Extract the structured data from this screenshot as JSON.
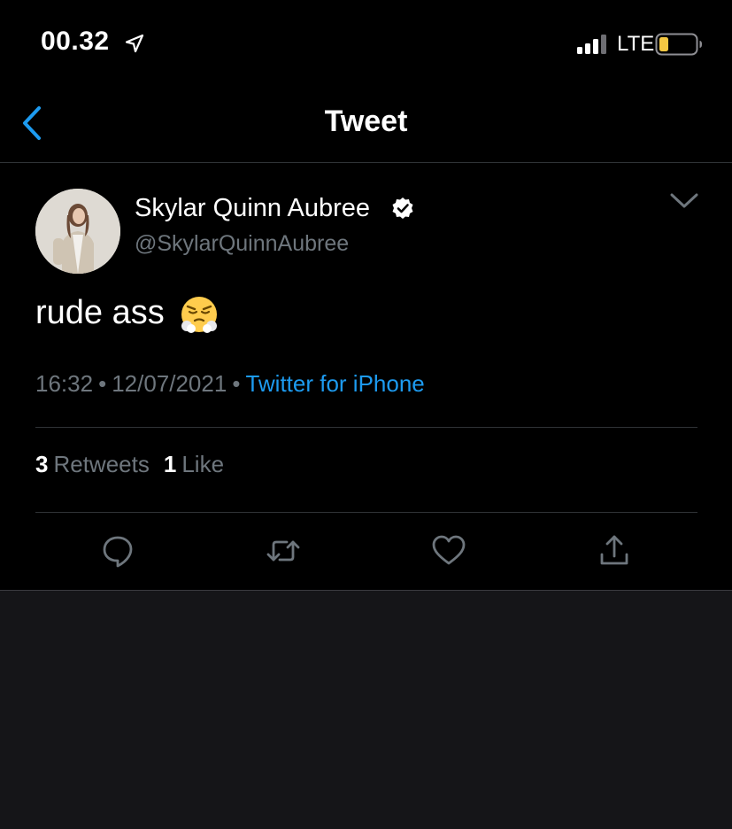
{
  "status_bar": {
    "time": "00.32",
    "network": "LTE",
    "icons": [
      "location-arrow-icon",
      "signal-bars-icon",
      "battery-low-icon"
    ]
  },
  "nav": {
    "title": "Tweet",
    "back_icon": "chevron-left-icon"
  },
  "tweet": {
    "author": {
      "display_name": "Skylar Quinn Aubree",
      "handle": "@SkylarQuinnAubree",
      "verified": true
    },
    "text": "rude ass",
    "emoji": "😤",
    "time": "16:32",
    "date": "12/07/2021",
    "source": "Twitter for iPhone",
    "separator": "•",
    "stats": {
      "retweets_count": "3",
      "retweets_label": "Retweets",
      "likes_count": "1",
      "likes_label": "Like"
    },
    "actions": [
      "reply-icon",
      "retweet-icon",
      "like-icon",
      "share-icon"
    ]
  },
  "colors": {
    "background": "#000000",
    "accent": "#1d9bf0",
    "secondary_text": "#6e767d",
    "divider": "#2f3336",
    "battery": "#f5c842"
  }
}
